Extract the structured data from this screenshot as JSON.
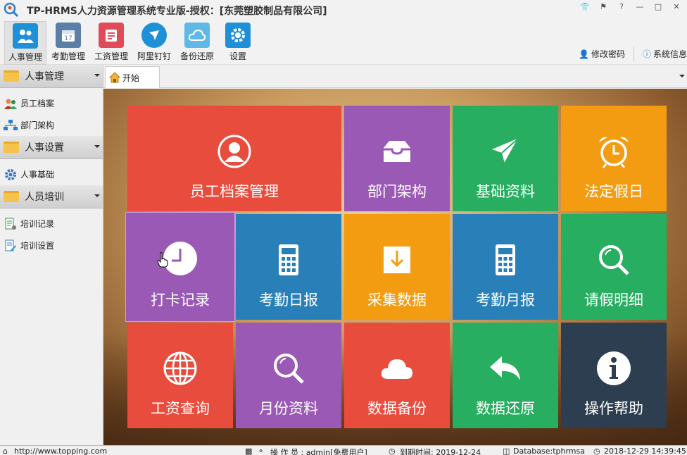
{
  "window": {
    "title": "TP-HRMS人力资源管理系统专业版-授权：[东莞塑胶制品有限公司]",
    "controls": [
      "skin-icon",
      "pin-icon",
      "help-icon",
      "minimize-icon",
      "maximize-icon",
      "close-icon"
    ]
  },
  "toolbar": {
    "items": [
      {
        "label": "人事管理",
        "icon": "people-icon",
        "color": "#1e90d8",
        "active": true
      },
      {
        "label": "考勤管理",
        "icon": "calendar-icon",
        "color": "#5b7fa6"
      },
      {
        "label": "工资管理",
        "icon": "payroll-icon",
        "color": "#e04b5a"
      },
      {
        "label": "阿里钉钉",
        "icon": "dingtalk-icon",
        "color": "#1e90d8"
      },
      {
        "label": "备份还原",
        "icon": "cloud-icon",
        "color": "#5fb8e6"
      },
      {
        "label": "设置",
        "icon": "gear-icon",
        "color": "#1e90d8"
      }
    ],
    "change_password": "修改密码",
    "system_info": "系统信息"
  },
  "sidebar": {
    "groups": [
      {
        "label": "人事管理",
        "items": [
          "员工档案",
          "部门架构"
        ]
      },
      {
        "label": "人事设置",
        "items": [
          "人事基础"
        ]
      },
      {
        "label": "人员培训",
        "items": [
          "培训记录",
          "培训设置"
        ]
      }
    ]
  },
  "tabs": {
    "start": "开始"
  },
  "tiles": [
    {
      "label": "员工档案管理",
      "icon": "user-icon",
      "color": "#e84c3d"
    },
    {
      "label": "部门架构",
      "icon": "inbox-icon",
      "color": "#9b59b6"
    },
    {
      "label": "基础资料",
      "icon": "paper-plane-icon",
      "color": "#27ae60"
    },
    {
      "label": "法定假日",
      "icon": "alarm-clock-icon",
      "color": "#f39c12"
    },
    {
      "label": "打卡记录",
      "icon": "clock-icon",
      "color": "#9b59b6"
    },
    {
      "label": "考勤日报",
      "icon": "calculator-icon",
      "color": "#2980b9"
    },
    {
      "label": "采集数据",
      "icon": "download-icon",
      "color": "#f39c12"
    },
    {
      "label": "考勤月报",
      "icon": "calculator-icon",
      "color": "#2980b9"
    },
    {
      "label": "请假明细",
      "icon": "search-icon",
      "color": "#27ae60"
    },
    {
      "label": "工资查询",
      "icon": "globe-icon",
      "color": "#e84c3d"
    },
    {
      "label": "月份资料",
      "icon": "search-icon",
      "color": "#9b59b6"
    },
    {
      "label": "数据备份",
      "icon": "cloud-icon",
      "color": "#e84c3d"
    },
    {
      "label": "数据还原",
      "icon": "reply-icon",
      "color": "#27ae60"
    },
    {
      "label": "操作帮助",
      "icon": "info-icon",
      "color": "#2c3e50"
    }
  ],
  "statusbar": {
    "url": "http://www.topping.com",
    "operator": "操 作 员 : admin[免费用户]",
    "expiry": "到期时间: 2019-12-24",
    "database": "Database:tphrmsa",
    "datetime": "2018-12-29 14:39:45"
  }
}
